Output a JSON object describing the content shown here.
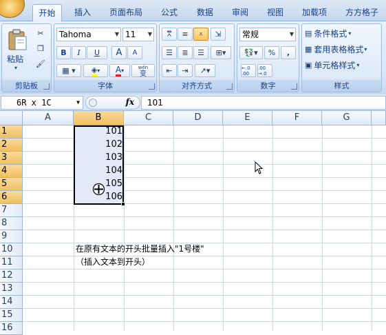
{
  "tabs": [
    "开始",
    "插入",
    "页面布局",
    "公式",
    "数据",
    "审阅",
    "视图",
    "加载项",
    "方方格子"
  ],
  "active_tab": "开始",
  "clipboard": {
    "paste_label": "粘贴",
    "group_label": "剪贴板"
  },
  "font": {
    "family": "Tahoma",
    "size": "11",
    "bold": "B",
    "italic": "I",
    "underline": "U",
    "grow": "A",
    "shrink": "A",
    "font_color_glyph": "A",
    "phonetic": "wén",
    "phonetic_char": "变",
    "group_label": "字体"
  },
  "alignment": {
    "group_label": "对齐方式"
  },
  "number": {
    "format": "常规",
    "percent": "%",
    "comma": ",",
    "inc_decimal": "←.0 .00",
    "dec_decimal": ".00 →.0",
    "group_label": "数字"
  },
  "styles": {
    "conditional": "条件格式",
    "table_format": "套用表格格式",
    "cell_styles": "单元格样式",
    "group_label": "样式"
  },
  "formula_bar": {
    "name_box": "6R x 1C",
    "fx": "fx",
    "value": "101"
  },
  "columns": [
    "A",
    "B",
    "C",
    "D",
    "E",
    "F",
    "G"
  ],
  "selected_column": "B",
  "rows": [
    "1",
    "2",
    "3",
    "4",
    "5",
    "6",
    "7",
    "8",
    "9",
    "10",
    "11",
    "12",
    "13",
    "14",
    "15",
    "16"
  ],
  "selected_rows": [
    "1",
    "2",
    "3",
    "4",
    "5",
    "6"
  ],
  "cells_b": [
    "101",
    "102",
    "103",
    "104",
    "105",
    "106"
  ],
  "notes": {
    "line1": "在原有文本的开头批量插入\"1号楼\"",
    "line2": "（插入文本到开头）"
  },
  "colors": {
    "selected_header": "#f1c15f",
    "ribbon": "#dbe7f7",
    "selection_fill": "#e3e9f6"
  }
}
